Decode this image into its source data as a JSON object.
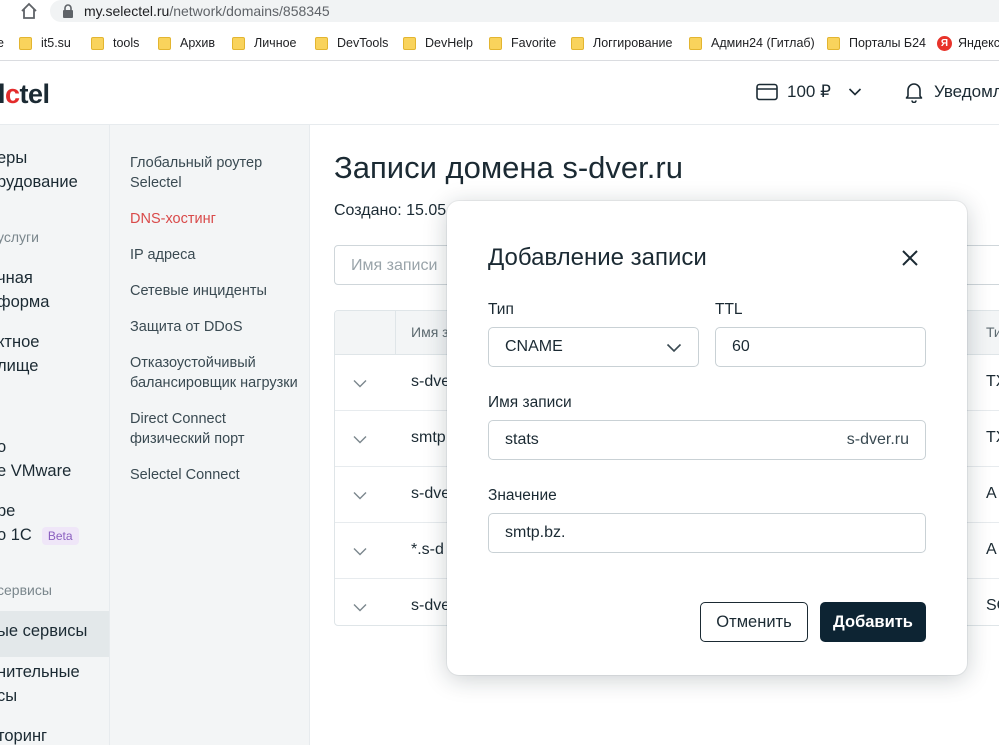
{
  "browser": {
    "url_host": "my.selectel.ru",
    "url_path": "/network/domains/858345",
    "bookmarks": [
      {
        "label": "е",
        "icon": "partial-icon"
      },
      {
        "label": "it5.su",
        "icon": "folder-icon"
      },
      {
        "label": "tools",
        "icon": "folder-icon"
      },
      {
        "label": "Архив",
        "icon": "folder-icon"
      },
      {
        "label": "Личное",
        "icon": "folder-icon"
      },
      {
        "label": "DevTools",
        "icon": "folder-icon"
      },
      {
        "label": "DevHelp",
        "icon": "folder-icon"
      },
      {
        "label": "Favorite",
        "icon": "folder-icon"
      },
      {
        "label": "Логгирование",
        "icon": "folder-icon"
      },
      {
        "label": "Админ24 (Гитлаб)",
        "icon": "folder-icon"
      },
      {
        "label": "Порталы Б24",
        "icon": "folder-icon"
      },
      {
        "label": "Яндекс",
        "icon": "yandex-icon"
      }
    ]
  },
  "header": {
    "logo_dark": "l",
    "logo_red": "c",
    "logo_end": "tel",
    "balance": "100 ₽",
    "notifications": "Уведомления"
  },
  "sidebar_main": {
    "items": [
      {
        "label": "еры"
      },
      {
        "label": "рудование"
      },
      {
        "label": "услуги",
        "category": true
      },
      {
        "label": "чная"
      },
      {
        "label": "форма"
      },
      {
        "label": "ктное"
      },
      {
        "label": "лище"
      },
      {
        "label": "о"
      },
      {
        "label": "е VMware"
      },
      {
        "label": "ре"
      },
      {
        "label": "о 1С"
      },
      {
        "label": "сервисы",
        "category": true
      },
      {
        "label": "ые сервисы",
        "active": true
      },
      {
        "label": "нительные"
      },
      {
        "label": "сы"
      },
      {
        "label": "торинг"
      }
    ],
    "beta": "Beta"
  },
  "sidebar_network": {
    "items": [
      {
        "label": "Глобальный роутер Selectel"
      },
      {
        "label": "DNS-хостинг",
        "active": true
      },
      {
        "label": "IP адреса"
      },
      {
        "label": "Сетевые инциденты"
      },
      {
        "label": "Защита от DDoS"
      },
      {
        "label": "Отказоустойчивый балансировщик нагрузки"
      },
      {
        "label": "Direct Connect физический порт"
      },
      {
        "label": "Selectel Connect"
      }
    ]
  },
  "main": {
    "title": "Записи домена s-dver.ru",
    "created": "Создано: 15.05",
    "search_placeholder": "Имя записи",
    "table": {
      "col_name": "Имя за",
      "col_type": "Ти",
      "rows": [
        {
          "name": "s-dve",
          "type": "TX"
        },
        {
          "name": "smtp",
          "type": "TX"
        },
        {
          "name": "s-dve",
          "type": "A"
        },
        {
          "name": "*.s-d",
          "type": "A"
        },
        {
          "name": "s-dve",
          "type": "SO"
        }
      ]
    }
  },
  "modal": {
    "title": "Добавление записи",
    "type_label": "Тип",
    "type_value": "CNAME",
    "ttl_label": "TTL",
    "ttl_value": "60",
    "name_label": "Имя записи",
    "name_value": "stats",
    "name_suffix": "s-dver.ru",
    "value_label": "Значение",
    "value_value": "smtp.bz.",
    "cancel": "Отменить",
    "submit": "Добавить"
  }
}
